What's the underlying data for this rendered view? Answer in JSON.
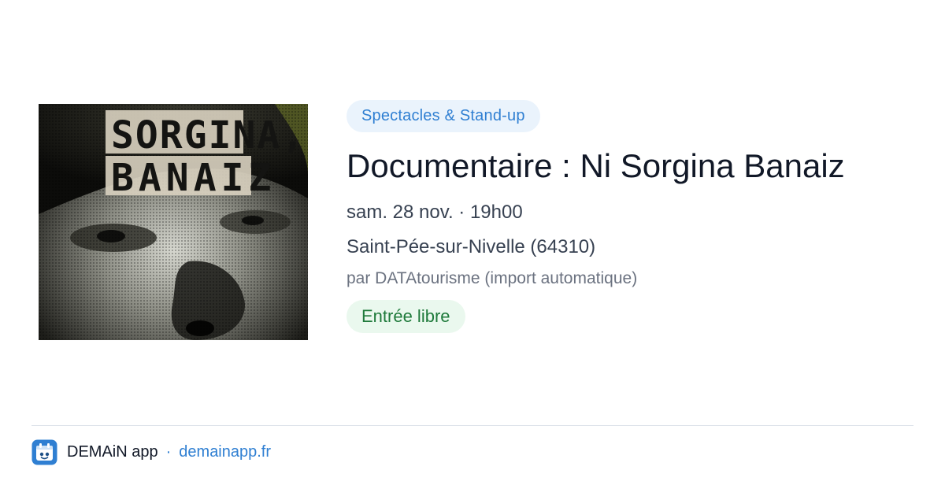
{
  "poster": {
    "title_line1": "SORGINA,",
    "title_line2": "BANAIZ",
    "icon": "documentary-poster-image"
  },
  "event": {
    "category": "Spectacles & Stand-up",
    "title": "Documentaire : Ni Sorgina Banaiz",
    "datetime": "sam. 28 nov. · 19h00",
    "location": "Saint-Pée-sur-Nivelle (64310)",
    "organizer": "par DATAtourisme (import automatique)",
    "price": "Entrée libre"
  },
  "footer": {
    "app_icon": "demain-app-icon",
    "app_name": "DEMAiN app",
    "separator": "·",
    "link_text": "demainapp.fr"
  },
  "colors": {
    "accent_blue": "#2f7fd2",
    "category_bg": "#eaf3fc",
    "price_green": "#1f7a3b",
    "price_bg": "#eaf8ee"
  }
}
